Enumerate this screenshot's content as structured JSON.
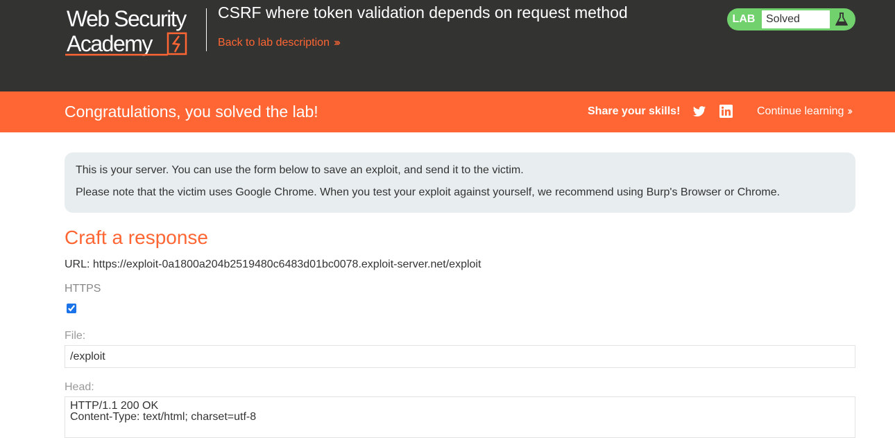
{
  "header": {
    "logo_line1": "Web Security",
    "logo_line2": "Academy",
    "lab_title": "CSRF where token validation depends on request method",
    "back_link": "Back to lab description",
    "status_tag": "LAB",
    "status_text": "Solved",
    "icons": [
      "academy-logo-icon",
      "chevron-right-icon",
      "flask-icon"
    ]
  },
  "banner": {
    "message": "Congratulations, you solved the lab!",
    "share_label": "Share your skills!",
    "continue_label": "Continue learning",
    "icons": [
      "twitter-icon",
      "linkedin-icon",
      "chevron-right-icon"
    ]
  },
  "notice": {
    "line1": "This is your server. You can use the form below to save an exploit, and send it to the victim.",
    "line2": "Please note that the victim uses Google Chrome. When you test your exploit against yourself, we recommend using Burp's Browser or Chrome."
  },
  "form": {
    "title": "Craft a response",
    "url_line": "URL: https://exploit-0a1800a204b2519480c6483d01bc0078.exploit-server.net/exploit",
    "https_label": "HTTPS",
    "https_checked": true,
    "file_label": "File:",
    "file_value": "/exploit",
    "head_label": "Head:",
    "head_value": "HTTP/1.1 200 OK\nContent-Type: text/html; charset=utf-8"
  },
  "colors": {
    "header_bg": "#333332",
    "accent": "#ff6633",
    "solved": "#70d16d",
    "notice_bg": "#e8edf0"
  }
}
